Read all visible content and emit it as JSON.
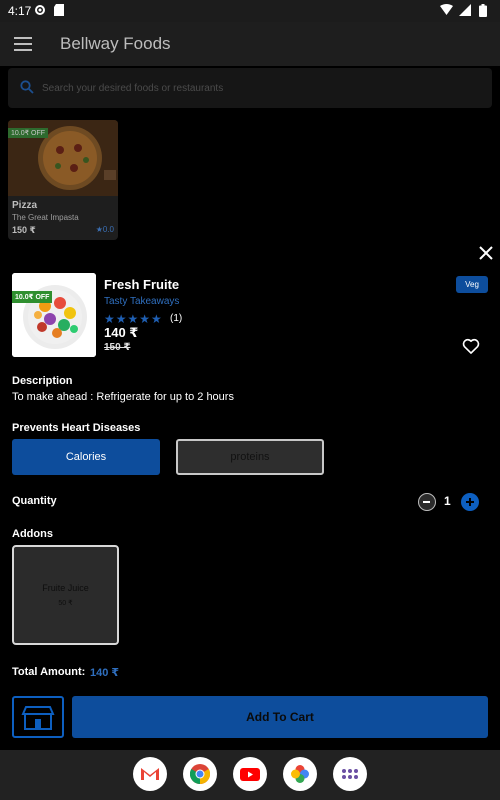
{
  "status_bar": {
    "time": "4:17"
  },
  "app_bar": {
    "title": "Bellway Foods"
  },
  "search": {
    "placeholder": "Search your desired foods or restaurants"
  },
  "background_card": {
    "offer": "10.0₹ OFF",
    "name": "Pizza",
    "shop": "The Great Impasta",
    "price": "150 ₹",
    "rating": "0.0"
  },
  "product": {
    "offer": "10.0₹ OFF",
    "name": "Fresh Fruite",
    "shop": "Tasty Takeaways",
    "rating_stars": "★★★★★",
    "review_count": "(1)",
    "price": "140 ₹",
    "old_price": "150 ₹",
    "diet_badge": "Veg"
  },
  "description": {
    "label": "Description",
    "text": "To make ahead : Refrigerate for up to 2 hours"
  },
  "benefit": {
    "label": "Prevents Heart Diseases",
    "chips": [
      "Calories",
      "proteins"
    ]
  },
  "quantity": {
    "label": "Quantity",
    "value": "1"
  },
  "addons": {
    "label": "Addons",
    "items": [
      {
        "name": "Fruite Juice",
        "price": "50 ₹"
      }
    ]
  },
  "total": {
    "label": "Total Amount:",
    "value": "140 ₹"
  },
  "actions": {
    "add_to_cart": "Add To Cart"
  },
  "dock_apps": [
    "gmail-icon",
    "chrome-icon",
    "youtube-icon",
    "photos-icon",
    "app-drawer-icon"
  ],
  "colors": {
    "accent": "#0d4d9c",
    "link": "#2f6fbf",
    "offer_green": "#2f8f2f"
  }
}
